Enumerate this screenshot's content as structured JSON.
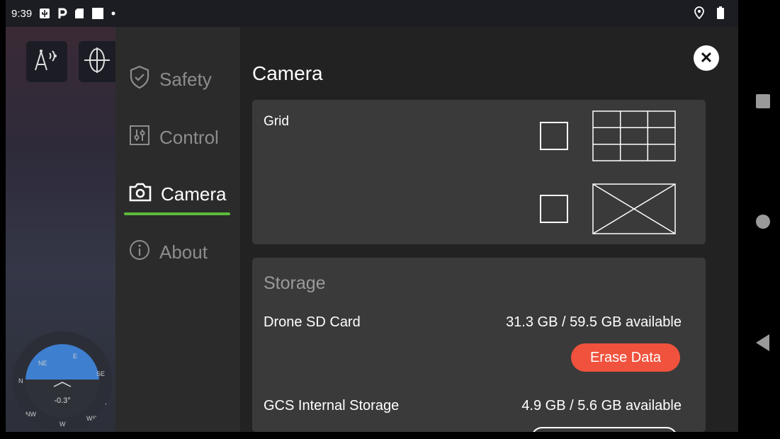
{
  "status_bar": {
    "time": "9:39"
  },
  "sidebar": {
    "items": [
      {
        "label": "Safety",
        "icon": "shield-check-icon",
        "active": false
      },
      {
        "label": "Control",
        "icon": "sliders-icon",
        "active": false
      },
      {
        "label": "Camera",
        "icon": "camera-icon",
        "active": true
      },
      {
        "label": "About",
        "icon": "info-icon",
        "active": false
      }
    ]
  },
  "background_app": {
    "attitude_readout": "-0.3°",
    "compass_labels": [
      "N",
      "NE",
      "E",
      "SE",
      "S",
      "W",
      "NW",
      "WS"
    ]
  },
  "panel": {
    "title": "Camera",
    "grid": {
      "label": "Grid",
      "options": [
        {
          "icon": "grid-3x3-icon",
          "checked": false
        },
        {
          "icon": "diagonal-cross-icon",
          "checked": false
        }
      ]
    },
    "storage": {
      "title": "Storage",
      "rows": [
        {
          "label": "Drone SD Card",
          "value": "31.3 GB / 59.5 GB available",
          "button": "Erase Data"
        },
        {
          "label": "GCS Internal Storage",
          "value": "4.9 GB / 5.6 GB available"
        }
      ]
    }
  },
  "colors": {
    "accent_underline": "#5dbb3a",
    "erase_button": "#f0523d",
    "panel_bg": "#222222",
    "card_bg": "#3a3a3a"
  }
}
